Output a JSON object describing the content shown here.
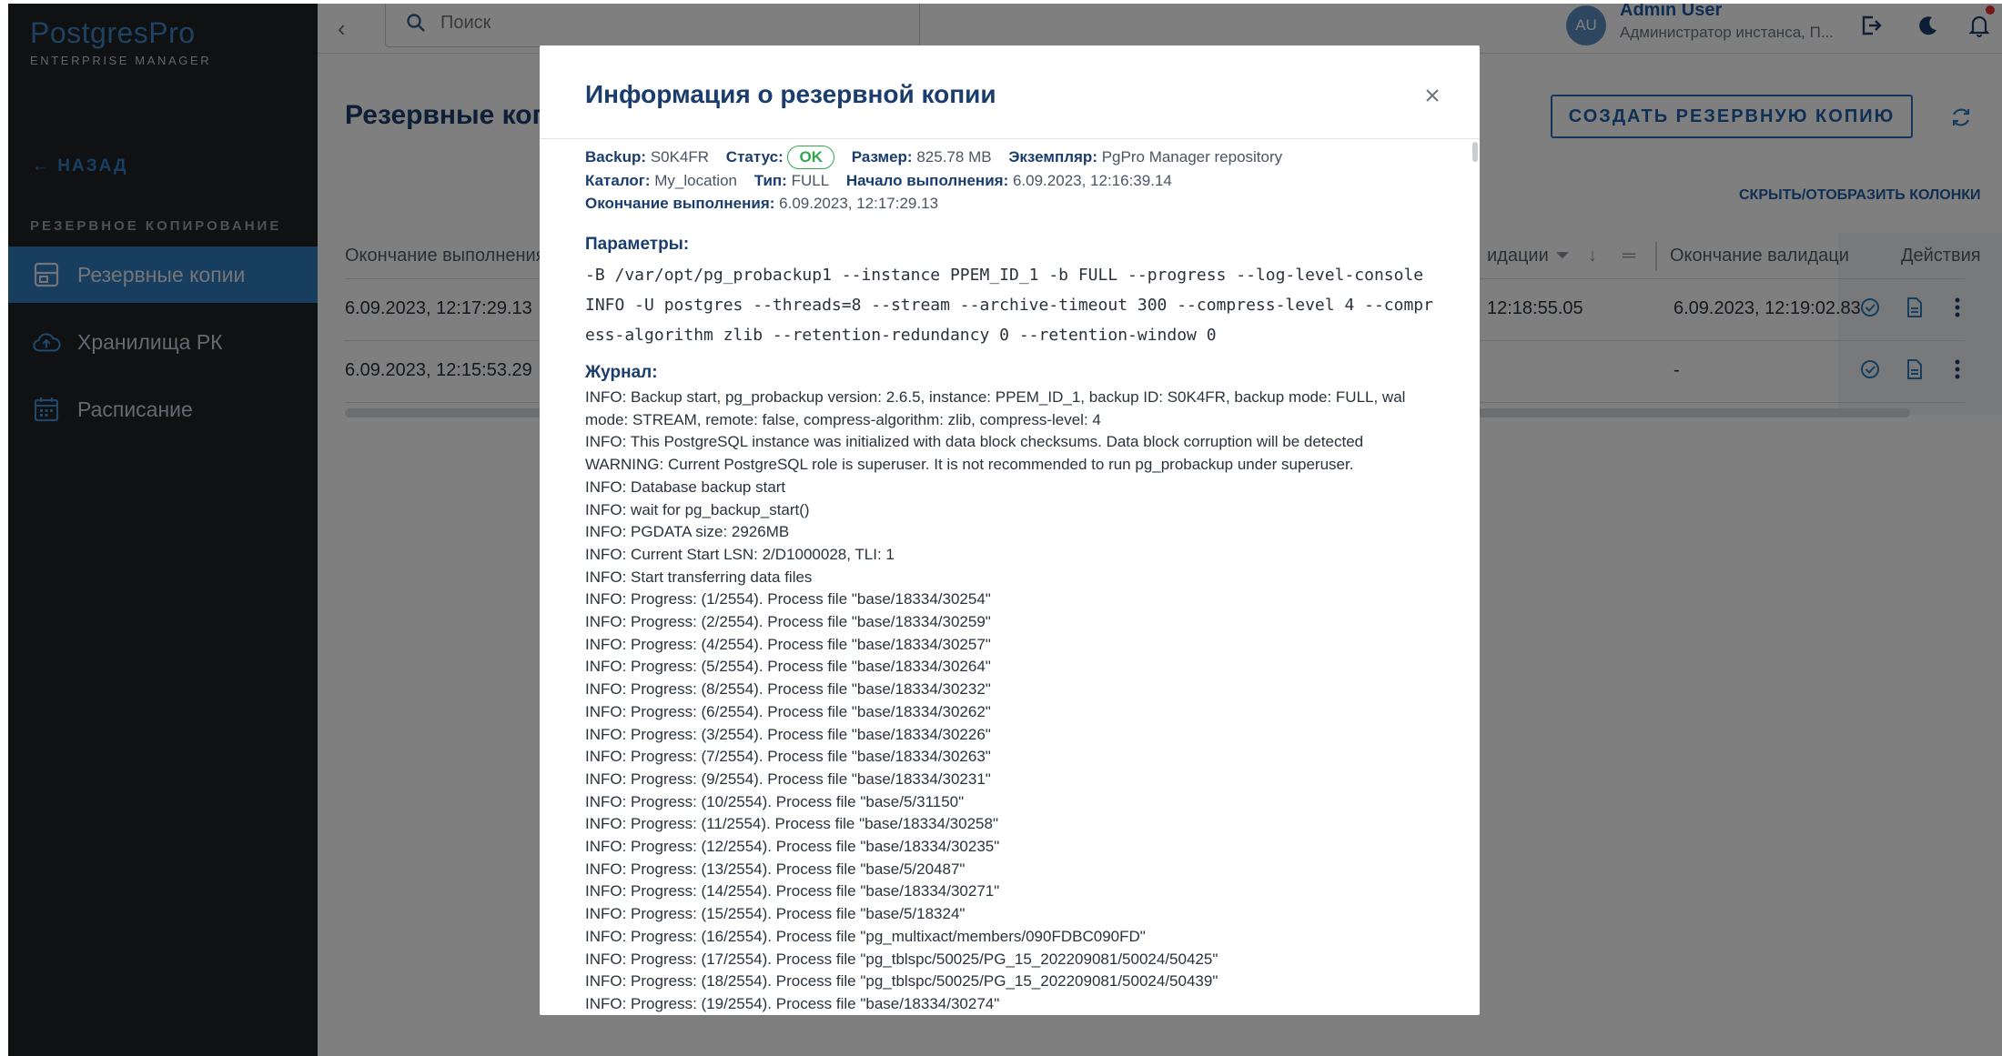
{
  "app": {
    "logo_text": "PostgresPro",
    "logo_subtitle": "ENTERPRISE MANAGER"
  },
  "sidebar": {
    "back_label": "← НАЗАД",
    "section_label": "РЕЗЕРВНОЕ КОПИРОВАНИЕ",
    "items": [
      {
        "label": "Резервные копии",
        "icon": "backup-icon"
      },
      {
        "label": "Хранилища РК",
        "icon": "cloud-upload-icon"
      },
      {
        "label": "Расписание",
        "icon": "calendar-icon"
      }
    ]
  },
  "header": {
    "search_placeholder": "Поиск",
    "avatar_initials": "AU",
    "user_name": "Admin User",
    "user_role": "Администратор инстанса, П..."
  },
  "main": {
    "page_title": "Резервные копии",
    "create_button": "СОЗДАТЬ РЕЗЕРВНУЮ КОПИЮ",
    "toggle_columns": "СКРЫТЬ/ОТОБРАЗИТЬ КОЛОНКИ",
    "columns": [
      "Окончание выполнения",
      "идации",
      "Окончание валидаци",
      "Действия"
    ],
    "rows": [
      {
        "end_time": "6.09.2023, 12:17:29.13",
        "validation_start": "12:18:55.05",
        "validation_end": "6.09.2023, 12:19:02.83"
      },
      {
        "end_time": "6.09.2023, 12:15:53.29",
        "validation_start": "",
        "validation_end": "-"
      }
    ]
  },
  "modal": {
    "title": "Информация о резервной копии",
    "meta": {
      "backup_label": "Backup:",
      "backup_value": "S0K4FR",
      "status_label": "Статус:",
      "status_value": "OK",
      "size_label": "Размер:",
      "size_value": "825.78 MB",
      "instance_label": "Экземпляр:",
      "instance_value": "PgPro Manager repository",
      "catalog_label": "Каталог:",
      "catalog_value": "My_location",
      "type_label": "Тип:",
      "type_value": "FULL",
      "start_label": "Начало выполнения:",
      "start_value": "6.09.2023, 12:16:39.14",
      "end_label": "Окончание выполнения:",
      "end_value": "6.09.2023, 12:17:29.13"
    },
    "params_heading": "Параметры:",
    "params_text": "-B /var/opt/pg_probackup1 --instance PPEM_ID_1 -b FULL --progress --log-level-console INFO -U postgres --threads=8 --stream --archive-timeout 300 --compress-level 4 --compress-algorithm zlib --retention-redundancy 0 --retention-window 0",
    "log_heading": "Журнал:",
    "log": [
      "INFO: Backup start, pg_probackup version: 2.6.5, instance: PPEM_ID_1, backup ID: S0K4FR, backup mode: FULL, wal mode: STREAM, remote: false, compress-algorithm: zlib, compress-level: 4",
      "INFO: This PostgreSQL instance was initialized with data block checksums. Data block corruption will be detected",
      "WARNING: Current PostgreSQL role is superuser. It is not recommended to run pg_probackup under superuser.",
      "INFO: Database backup start",
      "INFO: wait for pg_backup_start()",
      "INFO: PGDATA size: 2926MB",
      "INFO: Current Start LSN: 2/D1000028, TLI: 1",
      "INFO: Start transferring data files",
      "INFO: Progress: (1/2554). Process file \"base/18334/30254\"",
      "INFO: Progress: (2/2554). Process file \"base/18334/30259\"",
      "INFO: Progress: (4/2554). Process file \"base/18334/30257\"",
      "INFO: Progress: (5/2554). Process file \"base/18334/30264\"",
      "INFO: Progress: (8/2554). Process file \"base/18334/30232\"",
      "INFO: Progress: (6/2554). Process file \"base/18334/30262\"",
      "INFO: Progress: (3/2554). Process file \"base/18334/30226\"",
      "INFO: Progress: (7/2554). Process file \"base/18334/30263\"",
      "INFO: Progress: (9/2554). Process file \"base/18334/30231\"",
      "INFO: Progress: (10/2554). Process file \"base/5/31150\"",
      "INFO: Progress: (11/2554). Process file \"base/18334/30258\"",
      "INFO: Progress: (12/2554). Process file \"base/18334/30235\"",
      "INFO: Progress: (13/2554). Process file \"base/5/20487\"",
      "INFO: Progress: (14/2554). Process file \"base/18334/30271\"",
      "INFO: Progress: (15/2554). Process file \"base/5/18324\"",
      "INFO: Progress: (16/2554). Process file \"pg_multixact/members/090FDBC090FD\"",
      "INFO: Progress: (17/2554). Process file \"pg_tblspc/50025/PG_15_202209081/50024/50425\"",
      "INFO: Progress: (18/2554). Process file \"pg_tblspc/50025/PG_15_202209081/50024/50439\"",
      "INFO: Progress: (19/2554). Process file \"base/18334/30274\""
    ]
  },
  "colors": {
    "sidebar_bg": "#1e2227",
    "accent": "#2e7bbf",
    "title": "#1b3d6e",
    "ok": "#2fa84f"
  }
}
